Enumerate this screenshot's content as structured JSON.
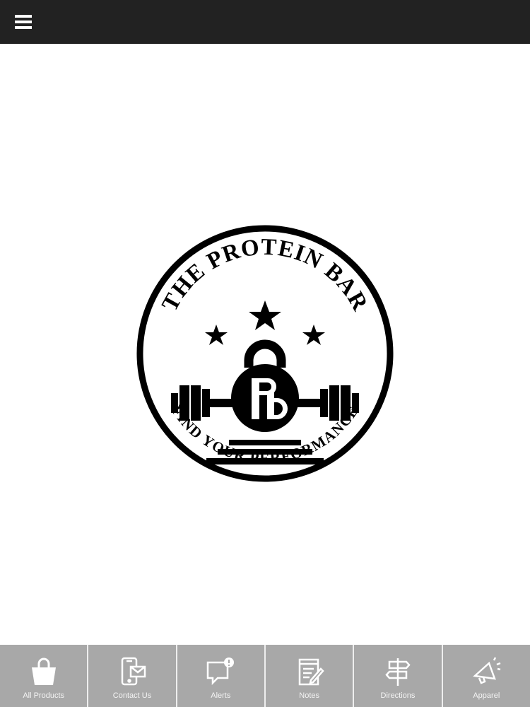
{
  "header": {
    "menu_icon": "hamburger-icon",
    "background": "#222222"
  },
  "logo": {
    "top_text": "THE PROTEIN BAR",
    "bottom_text": "FIND YOUR PERFORMANCE",
    "monogram": "PB"
  },
  "tabbar": {
    "background": "#a8a8a8",
    "items": [
      {
        "label": "All Products",
        "icon": "shopping-bag-icon"
      },
      {
        "label": "Contact Us",
        "icon": "phone-mail-icon"
      },
      {
        "label": "Alerts",
        "icon": "alert-bubble-icon"
      },
      {
        "label": "Notes",
        "icon": "notepad-icon"
      },
      {
        "label": "Directions",
        "icon": "signpost-icon"
      },
      {
        "label": "Apparel",
        "icon": "megaphone-icon"
      }
    ]
  }
}
